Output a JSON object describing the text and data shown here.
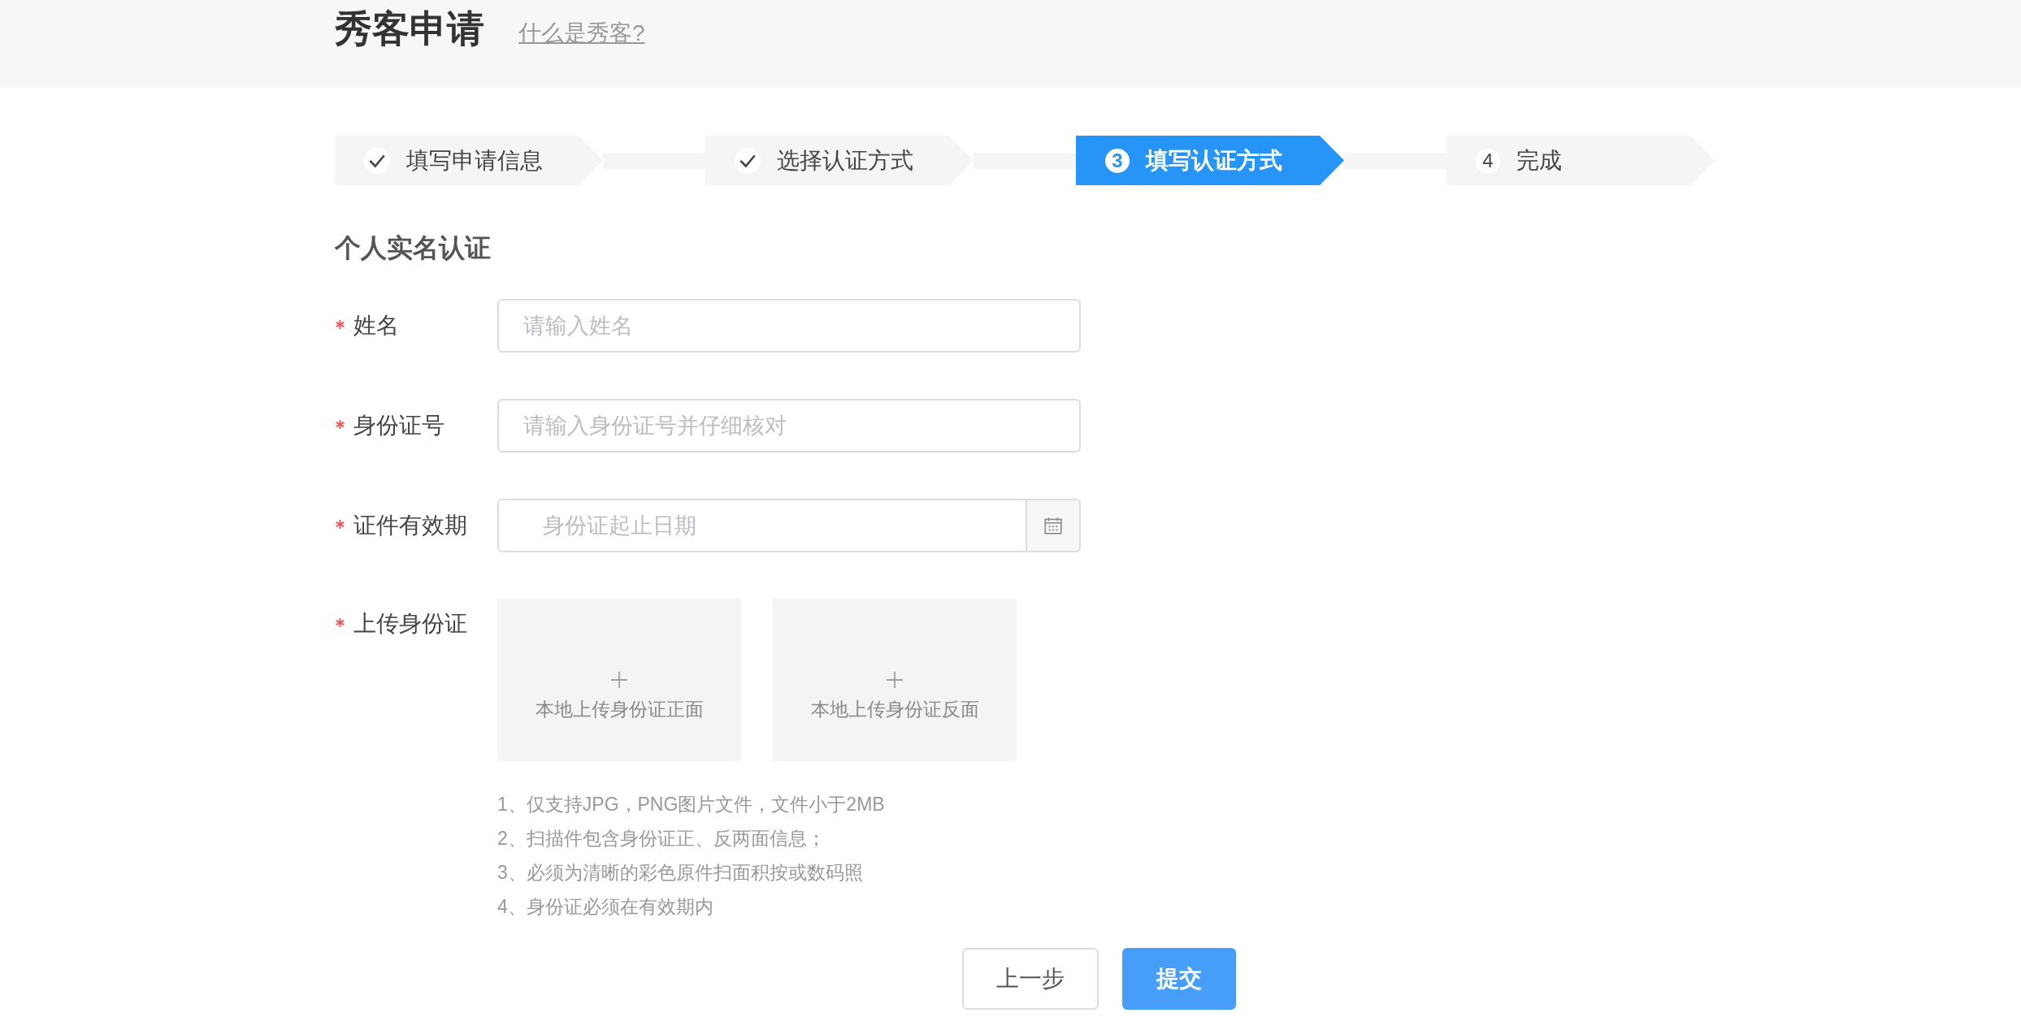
{
  "header": {
    "title": "秀客申请",
    "link": "什么是秀客?"
  },
  "steps": [
    {
      "label": "填写申请信息",
      "done": true,
      "selected": false
    },
    {
      "label": "选择认证方式",
      "done": true,
      "selected": false
    },
    {
      "marker": "3",
      "label": "填写认证方式",
      "done": false,
      "selected": true
    },
    {
      "marker": "4",
      "label": "完成",
      "done": false,
      "selected": false
    }
  ],
  "section_title": "个人实名认证",
  "fields": [
    {
      "kind": "text",
      "label": "姓名",
      "required": true,
      "placeholder": "请输入姓名"
    },
    {
      "kind": "text",
      "label": "身份证号",
      "required": true,
      "placeholder": "请输入身份证号并仔细核对"
    },
    {
      "kind": "date",
      "label": "证件有效期",
      "required": true,
      "placeholder": "身份证起止日期"
    }
  ],
  "upload": {
    "label": "上传身份证",
    "required": true,
    "slots": [
      {
        "label": "本地上传身份证正面"
      },
      {
        "label": "本地上传身份证反面"
      }
    ],
    "notes": [
      "1、仅支持JPG，PNG图片文件，文件小于2MB",
      "2、扫描件包含身份证正、反两面信息；",
      "3、必须为清晰的彩色原件扫面积按或数码照",
      "4、身份证必须在有效期内"
    ]
  },
  "buttons": [
    {
      "label": "上一步",
      "kind": "secondary"
    },
    {
      "label": "提交",
      "kind": "primary"
    }
  ]
}
